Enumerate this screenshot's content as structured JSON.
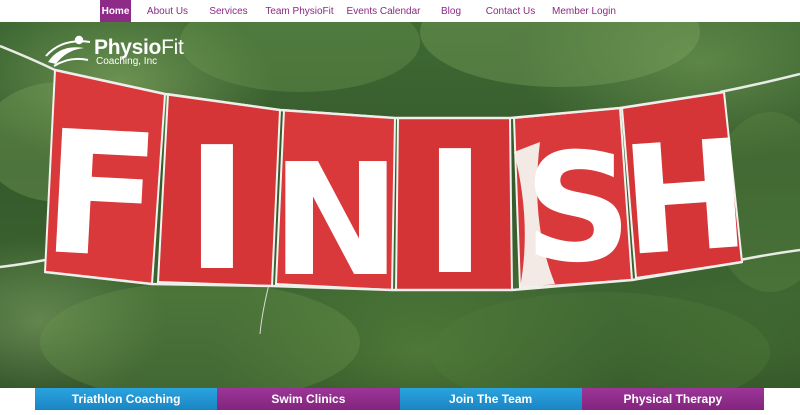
{
  "nav": {
    "items": [
      {
        "label": "Home",
        "active": true
      },
      {
        "label": "About Us"
      },
      {
        "label": "Services"
      },
      {
        "label": "Team PhysioFit"
      },
      {
        "label": "Events Calendar"
      },
      {
        "label": "Blog"
      },
      {
        "label": "Contact Us"
      },
      {
        "label": "Member Login"
      }
    ]
  },
  "brand": {
    "name_bold": "Physio",
    "name_light": "Fit",
    "subtitle": "Coaching, Inc",
    "icon": "swimmer-swoosh-icon"
  },
  "hero": {
    "banner_letters": [
      "F",
      "I",
      "N",
      "I",
      "S",
      "H"
    ],
    "flag_color": "#d9393b",
    "letter_color": "#ffffff"
  },
  "services": {
    "buttons": [
      {
        "label": "Triathlon Coaching",
        "color": "#1f92d0"
      },
      {
        "label": "Swim Clinics",
        "color": "#8e2b89"
      },
      {
        "label": "Join The Team",
        "color": "#1f92d0"
      },
      {
        "label": "Physical Therapy",
        "color": "#8e2b89"
      }
    ]
  },
  "colors": {
    "accent_purple": "#8e2b89",
    "accent_blue": "#1f92d0"
  }
}
